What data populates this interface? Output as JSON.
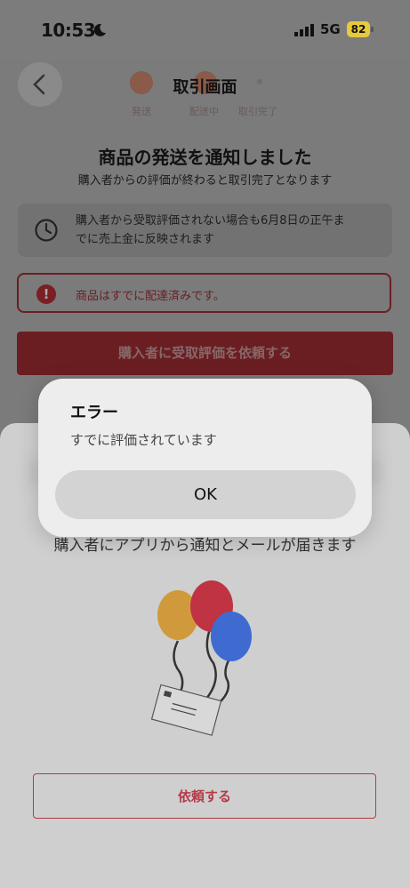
{
  "status_bar": {
    "time": "10:53",
    "network": "5G",
    "battery": "82"
  },
  "header": {
    "title": "取引画面",
    "steps": [
      "発送",
      "配送中",
      "取引完了"
    ]
  },
  "notice": {
    "headline": "商品の発送を通知しました",
    "subline": "購入者からの評価が終わると取引完了となります",
    "info_line1": "購入者から受取評価されない場合も6月8日の正午ま",
    "info_line2": "でに売上金に反映されます",
    "alert": "商品はすでに配達済みです。",
    "request_button": "購入者に受取評価を依頼する"
  },
  "sheet": {
    "description": "購入者にアプリから通知とメールが届きます",
    "request_button": "依頼する"
  },
  "dialog": {
    "title": "エラー",
    "message": "すでに評価されています",
    "ok_label": "OK"
  },
  "colors": {
    "accent": "#b53a47",
    "overlay": "#7b7b7b",
    "dialog_bg": "#ededed"
  }
}
